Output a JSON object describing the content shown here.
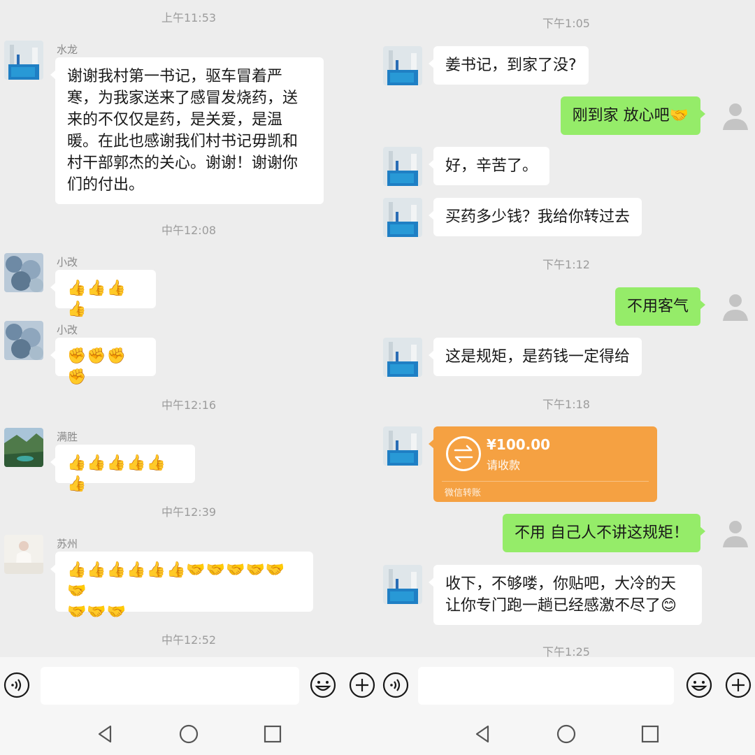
{
  "left": {
    "times": [
      "上午11:53",
      "中午12:08",
      "中午12:16",
      "中午12:39",
      "中午12:52"
    ],
    "messages": [
      {
        "sender": "水龙",
        "text": "谢谢我村第一书记，驱车冒着严\n寒，为我家送来了感冒发烧药，送\n来的不仅仅是药，是关爱，是温\n暖。在此也感谢我们村书记毋凯和\n村干部郭杰的关心。谢谢！谢谢你\n们的付出。"
      },
      {
        "sender": "小改",
        "text": "👍👍👍👍"
      },
      {
        "sender": "小改",
        "text": "✊✊✊✊"
      },
      {
        "sender": "满胜",
        "text": "👍👍👍👍👍👍"
      },
      {
        "sender": "苏州",
        "text": "👍👍👍👍👍👍🤝🤝🤝🤝🤝🤝\n🤝🤝🤝"
      }
    ]
  },
  "right": {
    "times": [
      "下午1:05",
      "下午1:12",
      "下午1:18",
      "下午1:25"
    ],
    "messages": [
      {
        "dir": "in",
        "text": "姜书记，到家了没?"
      },
      {
        "dir": "out",
        "text": "刚到家 放心吧🤝"
      },
      {
        "dir": "in",
        "text": "好，辛苦了。"
      },
      {
        "dir": "in",
        "text": "买药多少钱？我给你转过去"
      },
      {
        "dir": "out",
        "text": "不用客气"
      },
      {
        "dir": "in",
        "text": "这是规矩，是药钱一定得给"
      },
      {
        "dir": "out",
        "text": "不用 自己人不讲这规矩！"
      },
      {
        "dir": "in",
        "text": "收下，不够喽，你贴吧，大冷的天\n让你专门跑一趟已经感激不尽了😊"
      }
    ],
    "transfer": {
      "amount": "¥100.00",
      "hint": "请收款",
      "footer": "微信转账",
      "color": "#f5a142"
    }
  },
  "colors": {
    "background": "#ededed",
    "bubble_in": "#ffffff",
    "bubble_out": "#95ec69",
    "timestamp": "#9c9c9c"
  },
  "icons": [
    "voice-icon",
    "emoji-icon",
    "plus-icon",
    "nav-back-icon",
    "nav-home-icon",
    "nav-recents-icon",
    "default-avatar-icon",
    "transfer-icon"
  ]
}
